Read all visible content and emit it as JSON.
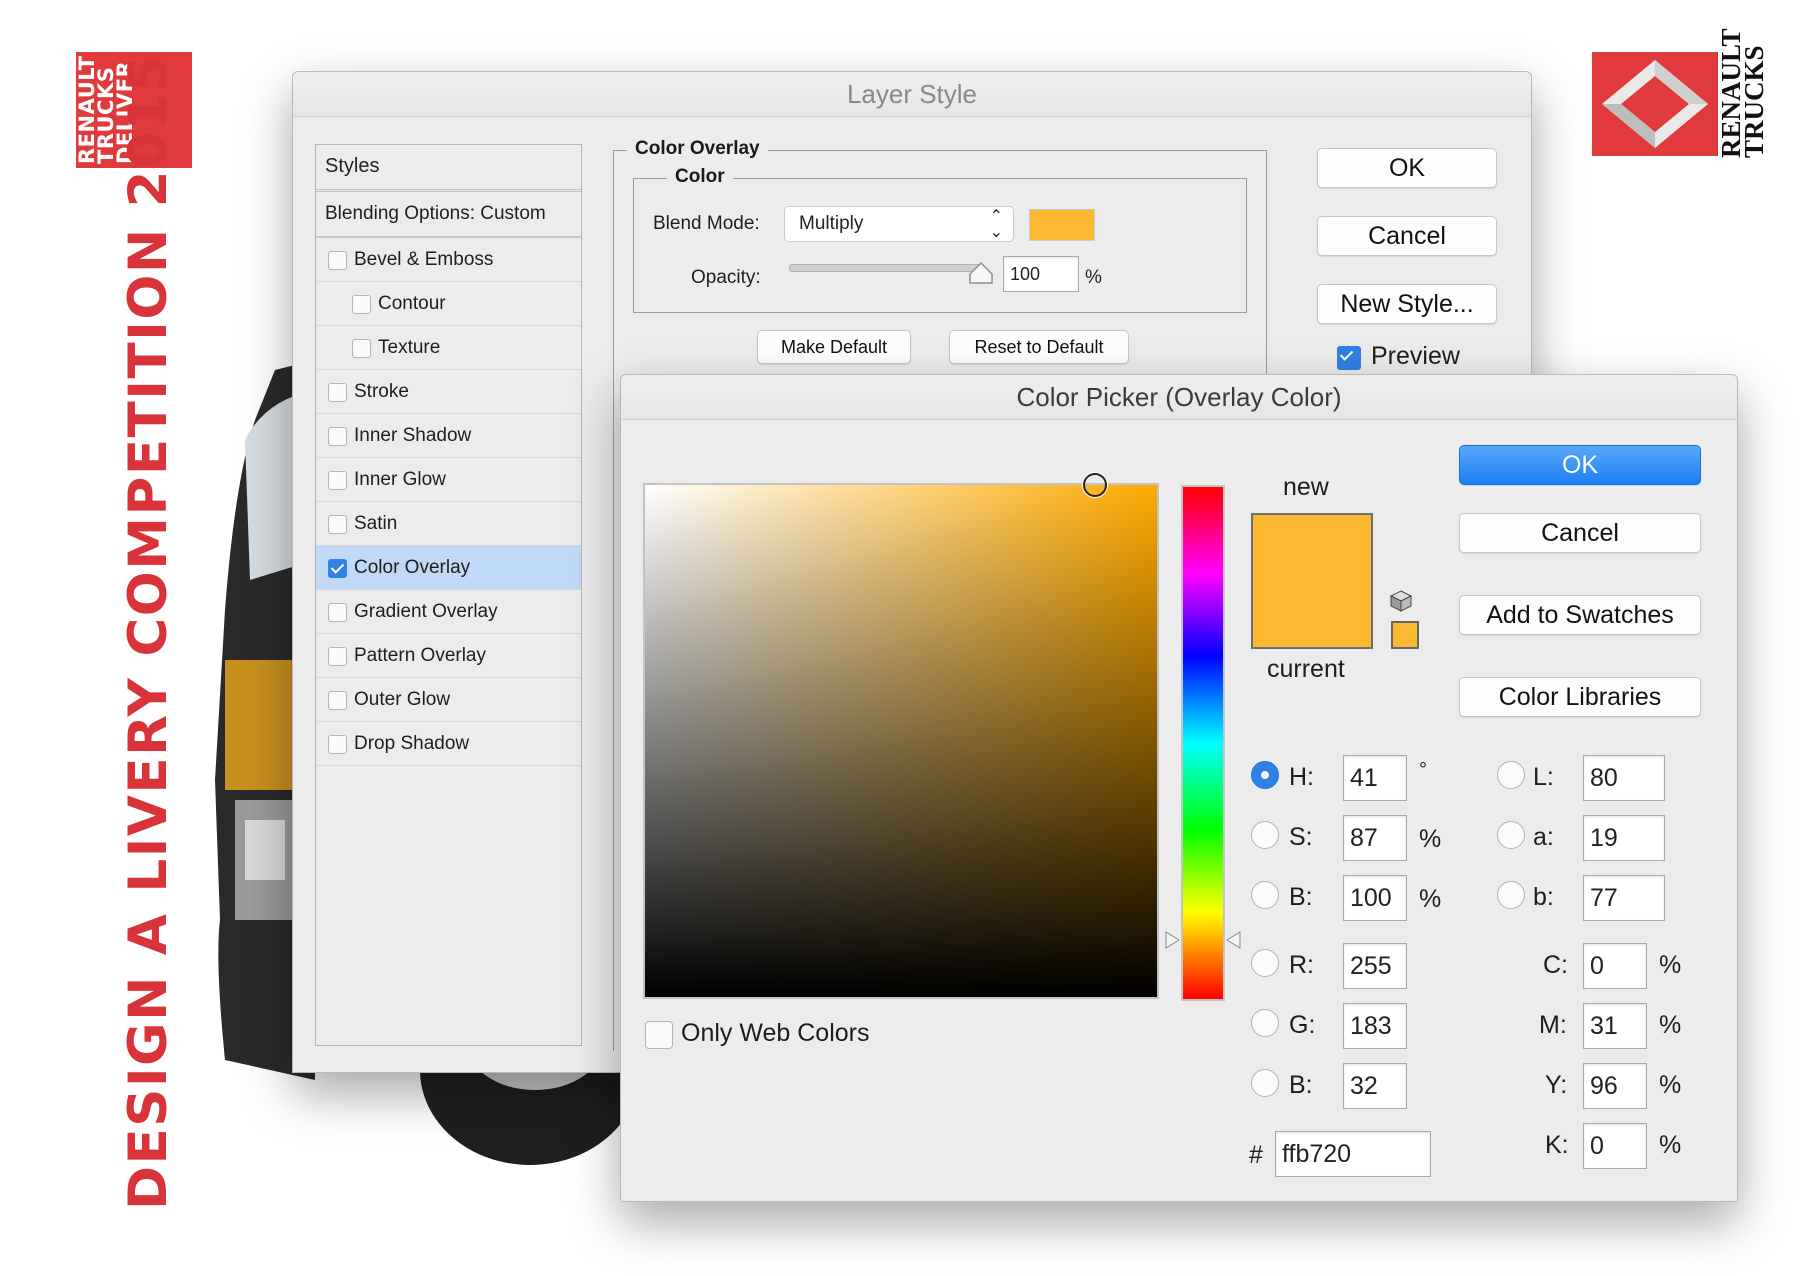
{
  "branding": {
    "logo_left_text": "RENAULT TRUCKS DELIVER",
    "logo_right_text": "RENAULT TRUCKS",
    "vertical_title": "DESIGN A LIVERY COMPETITION 2015",
    "accent_color": "#d8343a"
  },
  "layer_style": {
    "title": "Layer Style",
    "styles_header": "Styles",
    "blending_options": "Blending Options: Custom",
    "items": [
      {
        "label": "Bevel & Emboss",
        "checked": false,
        "sub": false
      },
      {
        "label": "Contour",
        "checked": false,
        "sub": true
      },
      {
        "label": "Texture",
        "checked": false,
        "sub": true
      },
      {
        "label": "Stroke",
        "checked": false,
        "sub": false
      },
      {
        "label": "Inner Shadow",
        "checked": false,
        "sub": false
      },
      {
        "label": "Inner Glow",
        "checked": false,
        "sub": false
      },
      {
        "label": "Satin",
        "checked": false,
        "sub": false
      },
      {
        "label": "Color Overlay",
        "checked": true,
        "sub": false,
        "selected": true
      },
      {
        "label": "Gradient Overlay",
        "checked": false,
        "sub": false
      },
      {
        "label": "Pattern Overlay",
        "checked": false,
        "sub": false
      },
      {
        "label": "Outer Glow",
        "checked": false,
        "sub": false
      },
      {
        "label": "Drop Shadow",
        "checked": false,
        "sub": false
      }
    ],
    "section_title": "Color Overlay",
    "subsection_title": "Color",
    "blend_mode_label": "Blend Mode:",
    "blend_mode_value": "Multiply",
    "opacity_label": "Opacity:",
    "opacity_value": "100",
    "opacity_unit": "%",
    "make_default": "Make Default",
    "reset_default": "Reset to Default",
    "ok": "OK",
    "cancel": "Cancel",
    "new_style": "New Style...",
    "preview_label": "Preview",
    "preview_checked": true,
    "overlay_color": "#fbb831"
  },
  "color_picker": {
    "title": "Color Picker (Overlay Color)",
    "ok": "OK",
    "cancel": "Cancel",
    "add_to_swatches": "Add to Swatches",
    "color_libraries": "Color Libraries",
    "new_label": "new",
    "current_label": "current",
    "only_web_colors": "Only Web Colors",
    "hsb": [
      {
        "label": "H:",
        "value": "41",
        "unit": "°",
        "selected": true
      },
      {
        "label": "S:",
        "value": "87",
        "unit": "%",
        "selected": false
      },
      {
        "label": "B:",
        "value": "100",
        "unit": "%",
        "selected": false
      }
    ],
    "rgb": [
      {
        "label": "R:",
        "value": "255"
      },
      {
        "label": "G:",
        "value": "183"
      },
      {
        "label": "B:",
        "value": "32"
      }
    ],
    "lab": [
      {
        "label": "L:",
        "value": "80"
      },
      {
        "label": "a:",
        "value": "19"
      },
      {
        "label": "b:",
        "value": "77"
      }
    ],
    "cmyk": [
      {
        "label": "C:",
        "value": "0",
        "unit": "%"
      },
      {
        "label": "M:",
        "value": "31",
        "unit": "%"
      },
      {
        "label": "Y:",
        "value": "96",
        "unit": "%"
      },
      {
        "label": "K:",
        "value": "0",
        "unit": "%"
      }
    ],
    "hex_label": "#",
    "hex_value": "ffb720",
    "new_color": "#fbb831",
    "current_color": "#fbb831",
    "primary_button_color": "#1c7ff2"
  }
}
